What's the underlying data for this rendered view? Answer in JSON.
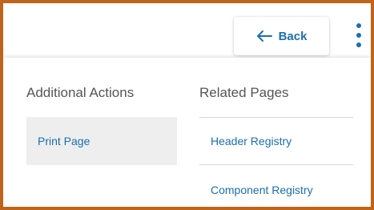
{
  "header": {
    "back_label": "Back",
    "back_icon": "arrow-left-icon",
    "more_icon": "kebab-vertical-icon"
  },
  "menu": {
    "additional_actions": {
      "title": "Additional Actions",
      "items": [
        {
          "label": "Print Page"
        }
      ]
    },
    "related_pages": {
      "title": "Related Pages",
      "items": [
        {
          "label": "Header Registry"
        },
        {
          "label": "Component Registry"
        }
      ]
    }
  },
  "colors": {
    "accent": "#1a6fb2",
    "frame_border": "#c0641c",
    "selected_bg": "#eeeeee",
    "heading_text": "#555555"
  }
}
